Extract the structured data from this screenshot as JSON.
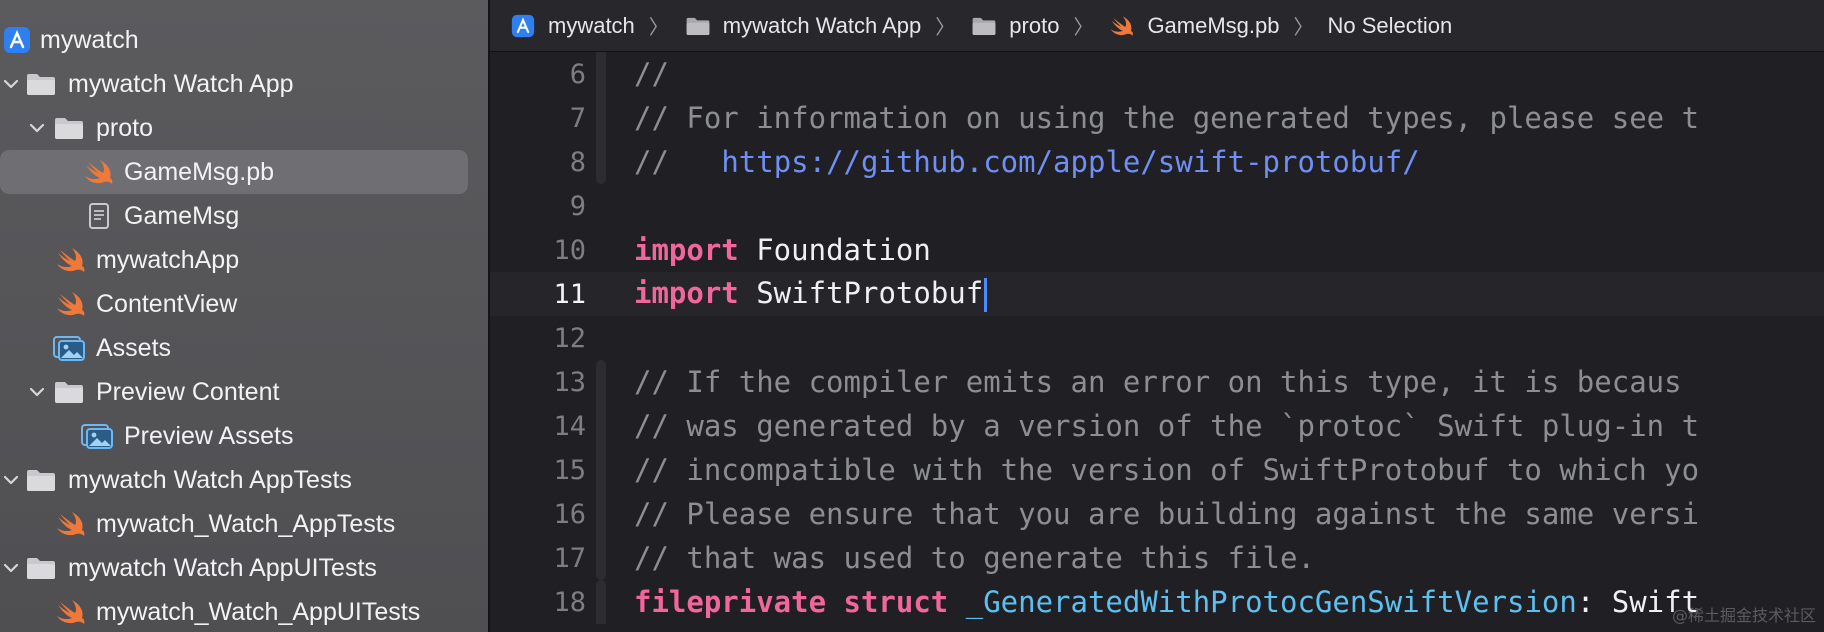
{
  "sidebar": {
    "items": [
      {
        "label": "mywatch",
        "icon": "app-project-icon"
      },
      {
        "label": "mywatch Watch App",
        "icon": "folder-icon"
      },
      {
        "label": "proto",
        "icon": "folder-icon"
      },
      {
        "label": "GameMsg.pb",
        "icon": "swift-icon"
      },
      {
        "label": "GameMsg",
        "icon": "document-icon"
      },
      {
        "label": "mywatchApp",
        "icon": "swift-icon"
      },
      {
        "label": "ContentView",
        "icon": "swift-icon"
      },
      {
        "label": "Assets",
        "icon": "assets-icon"
      },
      {
        "label": "Preview Content",
        "icon": "folder-icon"
      },
      {
        "label": "Preview Assets",
        "icon": "assets-icon"
      },
      {
        "label": "mywatch Watch AppTests",
        "icon": "folder-icon"
      },
      {
        "label": "mywatch_Watch_AppTests",
        "icon": "swift-icon"
      },
      {
        "label": "mywatch Watch AppUITests",
        "icon": "folder-icon"
      },
      {
        "label": "mywatch_Watch_AppUITests",
        "icon": "swift-icon"
      }
    ]
  },
  "jumpbar": {
    "crumbs": [
      "mywatch",
      "mywatch Watch App",
      "proto",
      "GameMsg.pb",
      "No Selection"
    ]
  },
  "editor": {
    "line_numbers": [
      "6",
      "7",
      "8",
      "9",
      "10",
      "11",
      "12",
      "13",
      "14",
      "15",
      "16",
      "17",
      "18"
    ],
    "current_line": "11",
    "lines": {
      "l6": "//",
      "l7": "// For information on using the generated types, please see t",
      "l8_prefix": "//   ",
      "l8_url": "https://github.com/apple/swift-protobuf/",
      "l10_kw": "import",
      "l10_rest": " Foundation",
      "l11_kw": "import",
      "l11_rest": " SwiftProtobuf",
      "l13": "// If the compiler emits an error on this type, it is becaus",
      "l14": "// was generated by a version of the `protoc` Swift plug-in t",
      "l15": "// incompatible with the version of SwiftProtobuf to which yo",
      "l16": "// Please ensure that you are building against the same versi",
      "l17": "// that was used to generate this file.",
      "l18_kw": "fileprivate struct",
      "l18_type": " _GeneratedWithProtocGenSwiftVersion",
      "l18_rest": ": Swift"
    }
  },
  "watermark": "@稀土掘金技术社区",
  "colors": {
    "sidebar_bg": "#56565a",
    "selection": "#6f6f73",
    "editor_bg": "#1f1f24",
    "comment": "#8d8e93",
    "keyword": "#f1669c",
    "url": "#6f8ff5",
    "type": "#5ec0f0",
    "swift_orange": "#f07838",
    "folder_gray": "#c8c8cc",
    "xcode_blue": "#2f7ff0"
  }
}
